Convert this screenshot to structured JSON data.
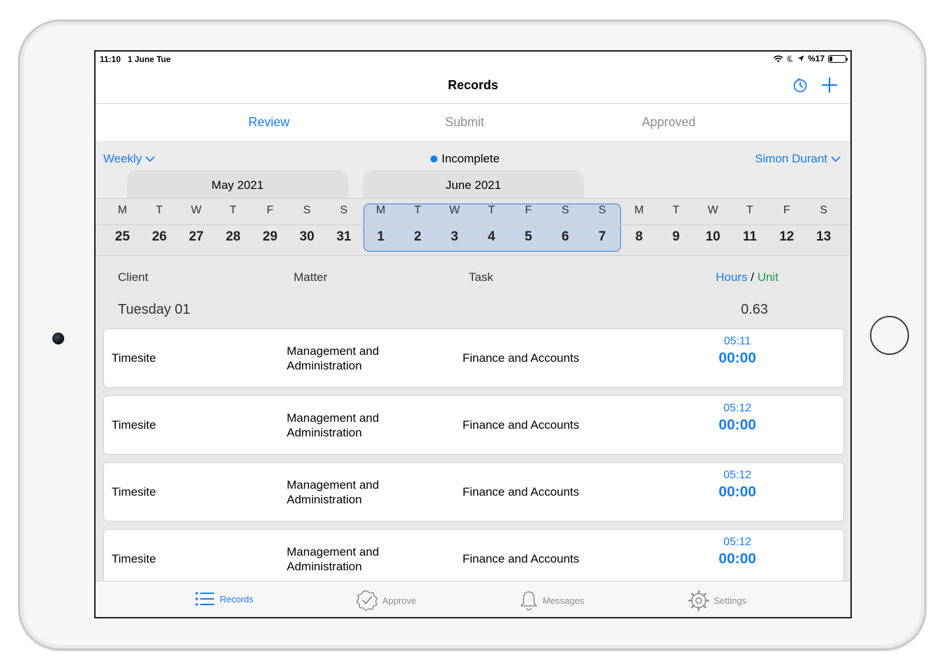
{
  "status_bar": {
    "time": "11:10",
    "date": "1 June Tue",
    "battery": "%17",
    "battery_level": 0.17
  },
  "nav": {
    "title": "Records",
    "timer_icon": "timer-icon",
    "add_icon": "plus-icon"
  },
  "segments": {
    "review": "Review",
    "submit": "Submit",
    "approved": "Approved",
    "active": "Review"
  },
  "filters": {
    "period": "Weekly",
    "status": "Incomplete",
    "user": "Simon Durant"
  },
  "calendar": {
    "months": [
      "May 2021",
      "June 2021"
    ],
    "days": [
      {
        "letter": "M",
        "num": "25"
      },
      {
        "letter": "T",
        "num": "26"
      },
      {
        "letter": "W",
        "num": "27"
      },
      {
        "letter": "T",
        "num": "28"
      },
      {
        "letter": "F",
        "num": "29"
      },
      {
        "letter": "S",
        "num": "30"
      },
      {
        "letter": "S",
        "num": "31"
      },
      {
        "letter": "M",
        "num": "1"
      },
      {
        "letter": "T",
        "num": "2"
      },
      {
        "letter": "W",
        "num": "3"
      },
      {
        "letter": "T",
        "num": "4"
      },
      {
        "letter": "F",
        "num": "5"
      },
      {
        "letter": "S",
        "num": "6"
      },
      {
        "letter": "S",
        "num": "7"
      },
      {
        "letter": "M",
        "num": "8"
      },
      {
        "letter": "T",
        "num": "9"
      },
      {
        "letter": "W",
        "num": "10"
      },
      {
        "letter": "T",
        "num": "11"
      },
      {
        "letter": "F",
        "num": "12"
      },
      {
        "letter": "S",
        "num": "13"
      }
    ],
    "selected_week": [
      "1",
      "2",
      "3",
      "4",
      "5",
      "6",
      "7"
    ]
  },
  "list": {
    "headers": {
      "client": "Client",
      "matter": "Matter",
      "task": "Task",
      "hours": "Hours",
      "slash": "/",
      "unit": "Unit"
    },
    "day_label": "Tuesday 01",
    "day_total": "0.63",
    "records": [
      {
        "client": "Timesite",
        "matter": "Management and Administration",
        "task": "Finance and Accounts",
        "time": "05:11",
        "hours": "00:00"
      },
      {
        "client": "Timesite",
        "matter": "Management and Administration",
        "task": "Finance and Accounts",
        "time": "05:12",
        "hours": "00:00"
      },
      {
        "client": "Timesite",
        "matter": "Management and Administration",
        "task": "Finance and Accounts",
        "time": "05:12",
        "hours": "00:00"
      },
      {
        "client": "Timesite",
        "matter": "Management and Administration",
        "task": "Finance and Accounts",
        "time": "05:12",
        "hours": "00:00"
      }
    ]
  },
  "tabbar": {
    "records": "Records",
    "approve": "Approve",
    "messages": "Messages",
    "settings": "Settings",
    "active": "Records"
  },
  "colors": {
    "accent": "#1a7cf0",
    "unit_green": "#1e9a4a",
    "inactive": "#8e8e8e"
  }
}
